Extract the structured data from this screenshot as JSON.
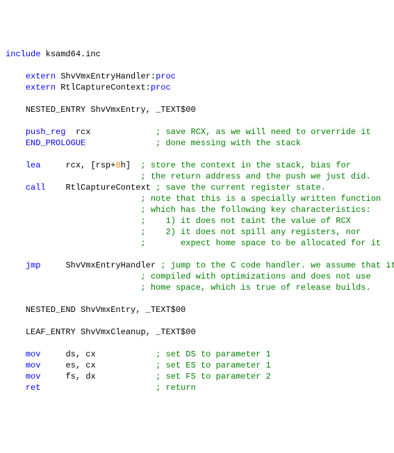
{
  "lines": [
    {
      "type": "directive",
      "indent": 0,
      "keyword": "include",
      "text": " ksamd64.inc"
    },
    {
      "type": "blank"
    },
    {
      "type": "extern",
      "indent": 4,
      "keyword": "extern",
      "name": " ShvVmxEntryHandler:",
      "proc": "proc"
    },
    {
      "type": "extern",
      "indent": 4,
      "keyword": "extern",
      "name": " RtlCaptureContext:",
      "proc": "proc"
    },
    {
      "type": "blank"
    },
    {
      "type": "plain",
      "indent": 4,
      "text": "NESTED_ENTRY ShvVmxEntry, _TEXT$00"
    },
    {
      "type": "blank"
    },
    {
      "type": "instr",
      "indent": 4,
      "mnemonic": "push_reg ",
      "operands": "rcx",
      "comment_col": 30,
      "comment": "; save RCX, as we will need to orverride it"
    },
    {
      "type": "instr",
      "indent": 4,
      "mnemonic": "END_PROLOGUE",
      "operands": "",
      "comment_col": 30,
      "comment": "; done messing with the stack"
    },
    {
      "type": "blank"
    },
    {
      "type": "instr_lea",
      "indent": 4,
      "mnemonic": "lea",
      "gap": "     ",
      "pre": "rcx, [rsp+",
      "num": "8",
      "post": "h]",
      "comment_col": 27,
      "comment": "; store the context in the stack, bias for"
    },
    {
      "type": "comment_only",
      "comment_col": 27,
      "comment": "; the return address and the push we just did."
    },
    {
      "type": "instr",
      "indent": 4,
      "mnemonic": "call",
      "gap": "    ",
      "operands": "RtlCaptureContext",
      "comment_col": 27,
      "comment": "; save the current register state."
    },
    {
      "type": "comment_only",
      "comment_col": 27,
      "comment": "; note that this is a specially written function"
    },
    {
      "type": "comment_only",
      "comment_col": 27,
      "comment": "; which has the following key characteristics:"
    },
    {
      "type": "comment_only",
      "comment_col": 27,
      "comment": ";    1) it does not taint the value of RCX"
    },
    {
      "type": "comment_only",
      "comment_col": 27,
      "comment": ";    2) it does not spill any registers, nor"
    },
    {
      "type": "comment_only",
      "comment_col": 27,
      "comment": ";       expect home space to be allocated for it"
    },
    {
      "type": "blank"
    },
    {
      "type": "instr",
      "indent": 4,
      "mnemonic": "jmp",
      "gap": "     ",
      "operands": "ShvVmxEntryHandler",
      "comment_col": 27,
      "comment": "; jump to the C code handler. we assume that it"
    },
    {
      "type": "comment_only",
      "comment_col": 27,
      "comment": "; compiled with optimizations and does not use"
    },
    {
      "type": "comment_only",
      "comment_col": 27,
      "comment": "; home space, which is true of release builds."
    },
    {
      "type": "blank"
    },
    {
      "type": "plain",
      "indent": 4,
      "text": "NESTED_END ShvVmxEntry, _TEXT$00"
    },
    {
      "type": "blank"
    },
    {
      "type": "plain",
      "indent": 4,
      "text": "LEAF_ENTRY ShvVmxCleanup, _TEXT$00"
    },
    {
      "type": "blank"
    },
    {
      "type": "instr",
      "indent": 4,
      "mnemonic": "mov",
      "gap": "     ",
      "operands": "ds, cx",
      "comment_col": 30,
      "comment": "; set DS to parameter 1"
    },
    {
      "type": "instr",
      "indent": 4,
      "mnemonic": "mov",
      "gap": "     ",
      "operands": "es, cx",
      "comment_col": 30,
      "comment": "; set ES to parameter 1"
    },
    {
      "type": "instr",
      "indent": 4,
      "mnemonic": "mov",
      "gap": "     ",
      "operands": "fs, dx",
      "comment_col": 30,
      "comment": "; set FS to parameter 2"
    },
    {
      "type": "instr",
      "indent": 4,
      "mnemonic": "ret",
      "gap": "",
      "operands": "",
      "comment_col": 30,
      "comment": "; return"
    }
  ]
}
